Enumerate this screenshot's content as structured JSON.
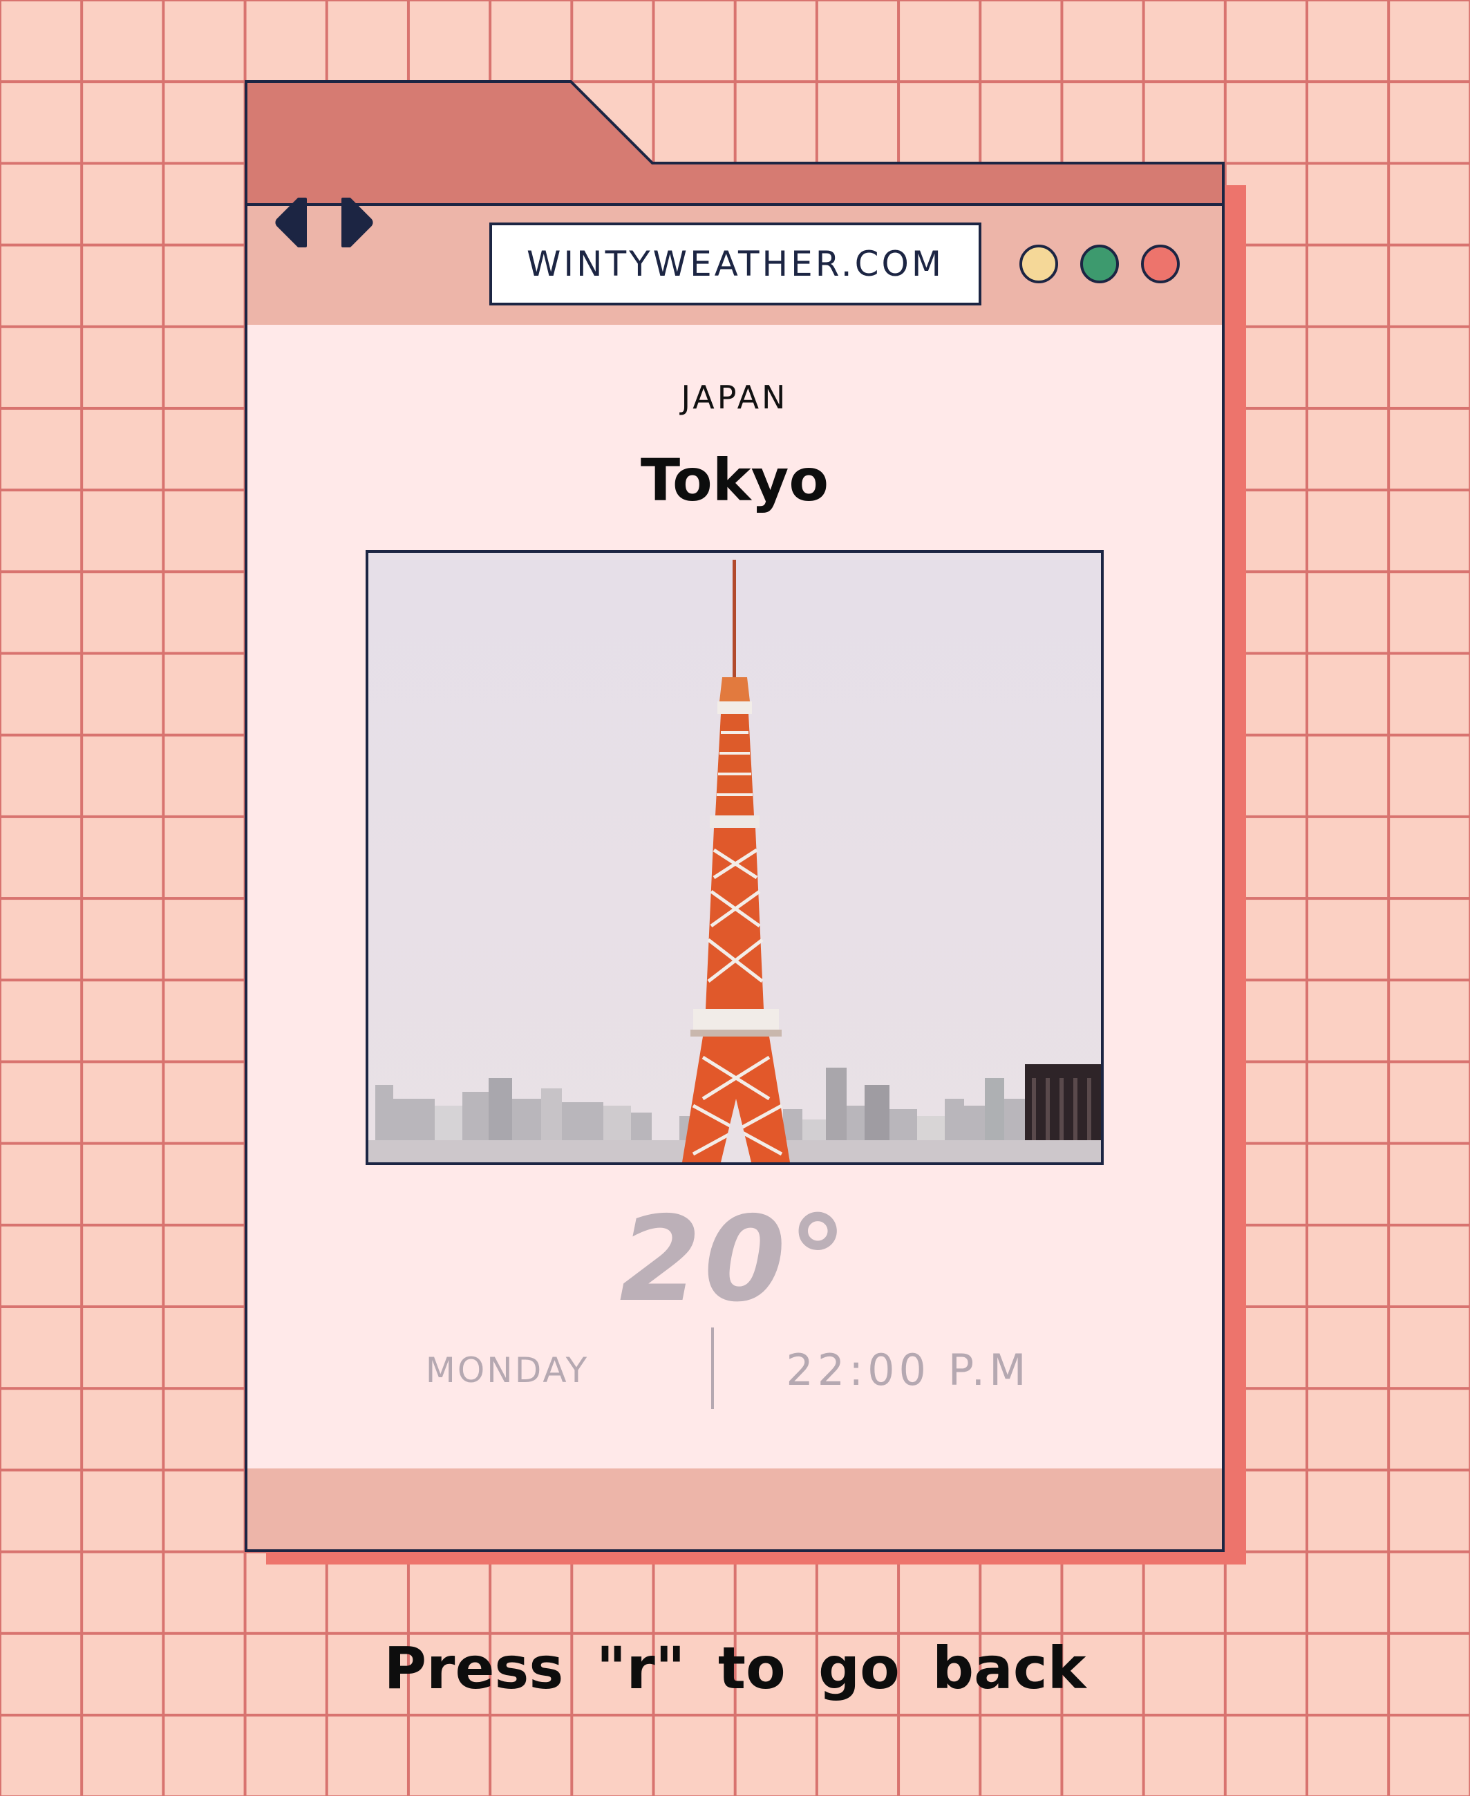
{
  "browser": {
    "url": "WINTYWEATHER.COM",
    "nav": {
      "back_icon": "caret-left-icon",
      "forward_icon": "caret-right-icon"
    },
    "window_buttons": [
      {
        "name": "minimize",
        "color": "#f5d898"
      },
      {
        "name": "maximize",
        "color": "#3d9a6e"
      },
      {
        "name": "close",
        "color": "#ed746c"
      }
    ]
  },
  "weather": {
    "country": "JAPAN",
    "city": "Tokyo",
    "temperature": "20°",
    "day": "MONDAY",
    "time": "22:00 P.M"
  },
  "footer_hint": "Press \"r\" to go back",
  "colors": {
    "background": "#fbd0c3",
    "grid": "#d8736f",
    "tab": "#d67b72",
    "toolbar": "#edb5a9",
    "content": "#ffe9e9",
    "shadow": "#ed746c",
    "outline": "#1c2543",
    "muted_text": "#b5a8b1"
  }
}
